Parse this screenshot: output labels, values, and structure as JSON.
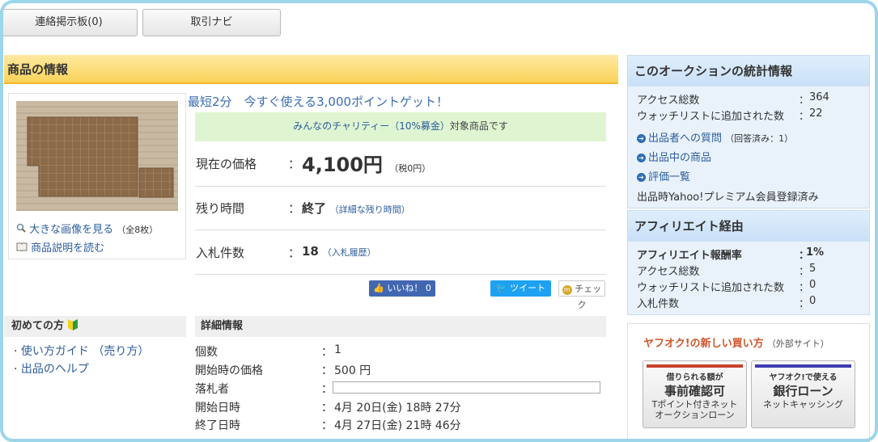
{
  "top_buttons": {
    "message_board": "連絡掲示板(0)",
    "trade_navi": "取引ナビ"
  },
  "product_section": {
    "title": "商品の情報"
  },
  "image_panel": {
    "large_image_link": "大きな画像を見る",
    "large_image_count": "（全8枚）",
    "description_link": "商品説明を読む"
  },
  "promo": {
    "text": "最短2分　今すぐ使える3,000ポイントゲット！"
  },
  "charity": {
    "link": "みんなのチャリティー（10%募金）",
    "suffix": "対象商品です"
  },
  "price_row": {
    "label": "現在の価格",
    "colon": "：",
    "value": "4,100円",
    "tax": "（税0円）"
  },
  "time_row": {
    "label": "残り時間",
    "colon": "：",
    "value": "終了",
    "detail": "（詳細な残り時間）"
  },
  "bids_row": {
    "label": "入札件数",
    "colon": "：",
    "value": "18",
    "history": "（入札履歴）"
  },
  "social": {
    "like": "いいね！ 0",
    "tweet": "ツイート",
    "check": "チェック"
  },
  "beginner": {
    "title": "初めての方",
    "links": [
      "使い方ガイド （売り方）",
      "出品のヘルプ"
    ]
  },
  "details": {
    "title": "詳細情報",
    "rows": [
      {
        "label": "個数",
        "colon": "：",
        "value": "1"
      },
      {
        "label": "開始時の価格",
        "colon": "：",
        "value": "500 円"
      },
      {
        "label": "落札者",
        "colon": "：",
        "value": ""
      },
      {
        "label": "開始日時",
        "colon": "：",
        "value": "4月 20日(金) 18時 27分"
      },
      {
        "label": "終了日時",
        "colon": "：",
        "value": "4月 27日(金) 21時 46分"
      }
    ]
  },
  "stats": {
    "title": "このオークションの統計情報",
    "access_label": "アクセス総数",
    "access_value": "364",
    "watch_label": "ウォッチリストに追加された数",
    "watch_value": "22",
    "colon": "：",
    "question_link": "出品者への質問",
    "question_note": "（回答済み：1）",
    "listing_link": "出品中の商品",
    "rating_link": "評価一覧",
    "premium_note": "出品時Yahoo!プレミアム会員登録済み"
  },
  "affiliate": {
    "title": "アフィリエイト経由",
    "rows": [
      {
        "label": "アフィリエイト報酬率",
        "colon": "：",
        "value": "1%"
      },
      {
        "label": "アクセス総数",
        "colon": "：",
        "value": "5"
      },
      {
        "label": "ウォッチリストに追加された数",
        "colon": "：",
        "value": "0"
      },
      {
        "label": "入札件数",
        "colon": "：",
        "value": "0"
      }
    ]
  },
  "new_way": {
    "title": "ヤフオク!の新しい買い方",
    "note": "（外部サイト）",
    "btn1": {
      "top": "借りられる額が",
      "main": "事前確認可",
      "sub1": "Tポイント付きネット",
      "sub2": "オークションローン"
    },
    "btn2": {
      "top": "ヤフオク!で使える",
      "main": "銀行ローン",
      "sub1": "ネットキャッシング"
    }
  },
  "colors": {
    "accent_link": "#2d5d9b",
    "header_yellow": "#fbd35a",
    "charity_green": "#dff5d2",
    "side_blue": "#e9f2fb"
  }
}
